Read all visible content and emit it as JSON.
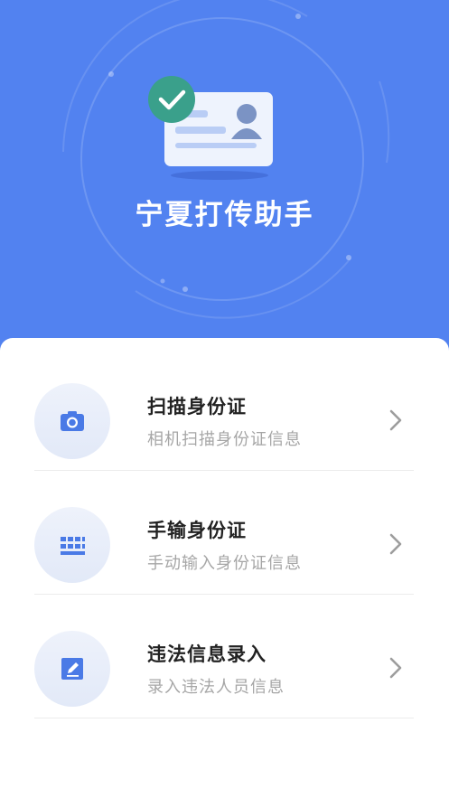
{
  "header": {
    "app_title": "宁夏打传助手",
    "background_color": "#5282f0",
    "illustration": "id-card-check-icon"
  },
  "menu": {
    "items": [
      {
        "title": "扫描身份证",
        "subtitle": "相机扫描身份证信息",
        "icon": "camera-icon"
      },
      {
        "title": "手输身份证",
        "subtitle": "手动输入身份证信息",
        "icon": "keyboard-icon"
      },
      {
        "title": "违法信息录入",
        "subtitle": "录入违法人员信息",
        "icon": "edit-icon"
      }
    ]
  },
  "colors": {
    "accent": "#5282f0",
    "check_badge": "#3aa08b",
    "icon_blue": "#4a7ae6",
    "divider": "#ececec"
  }
}
